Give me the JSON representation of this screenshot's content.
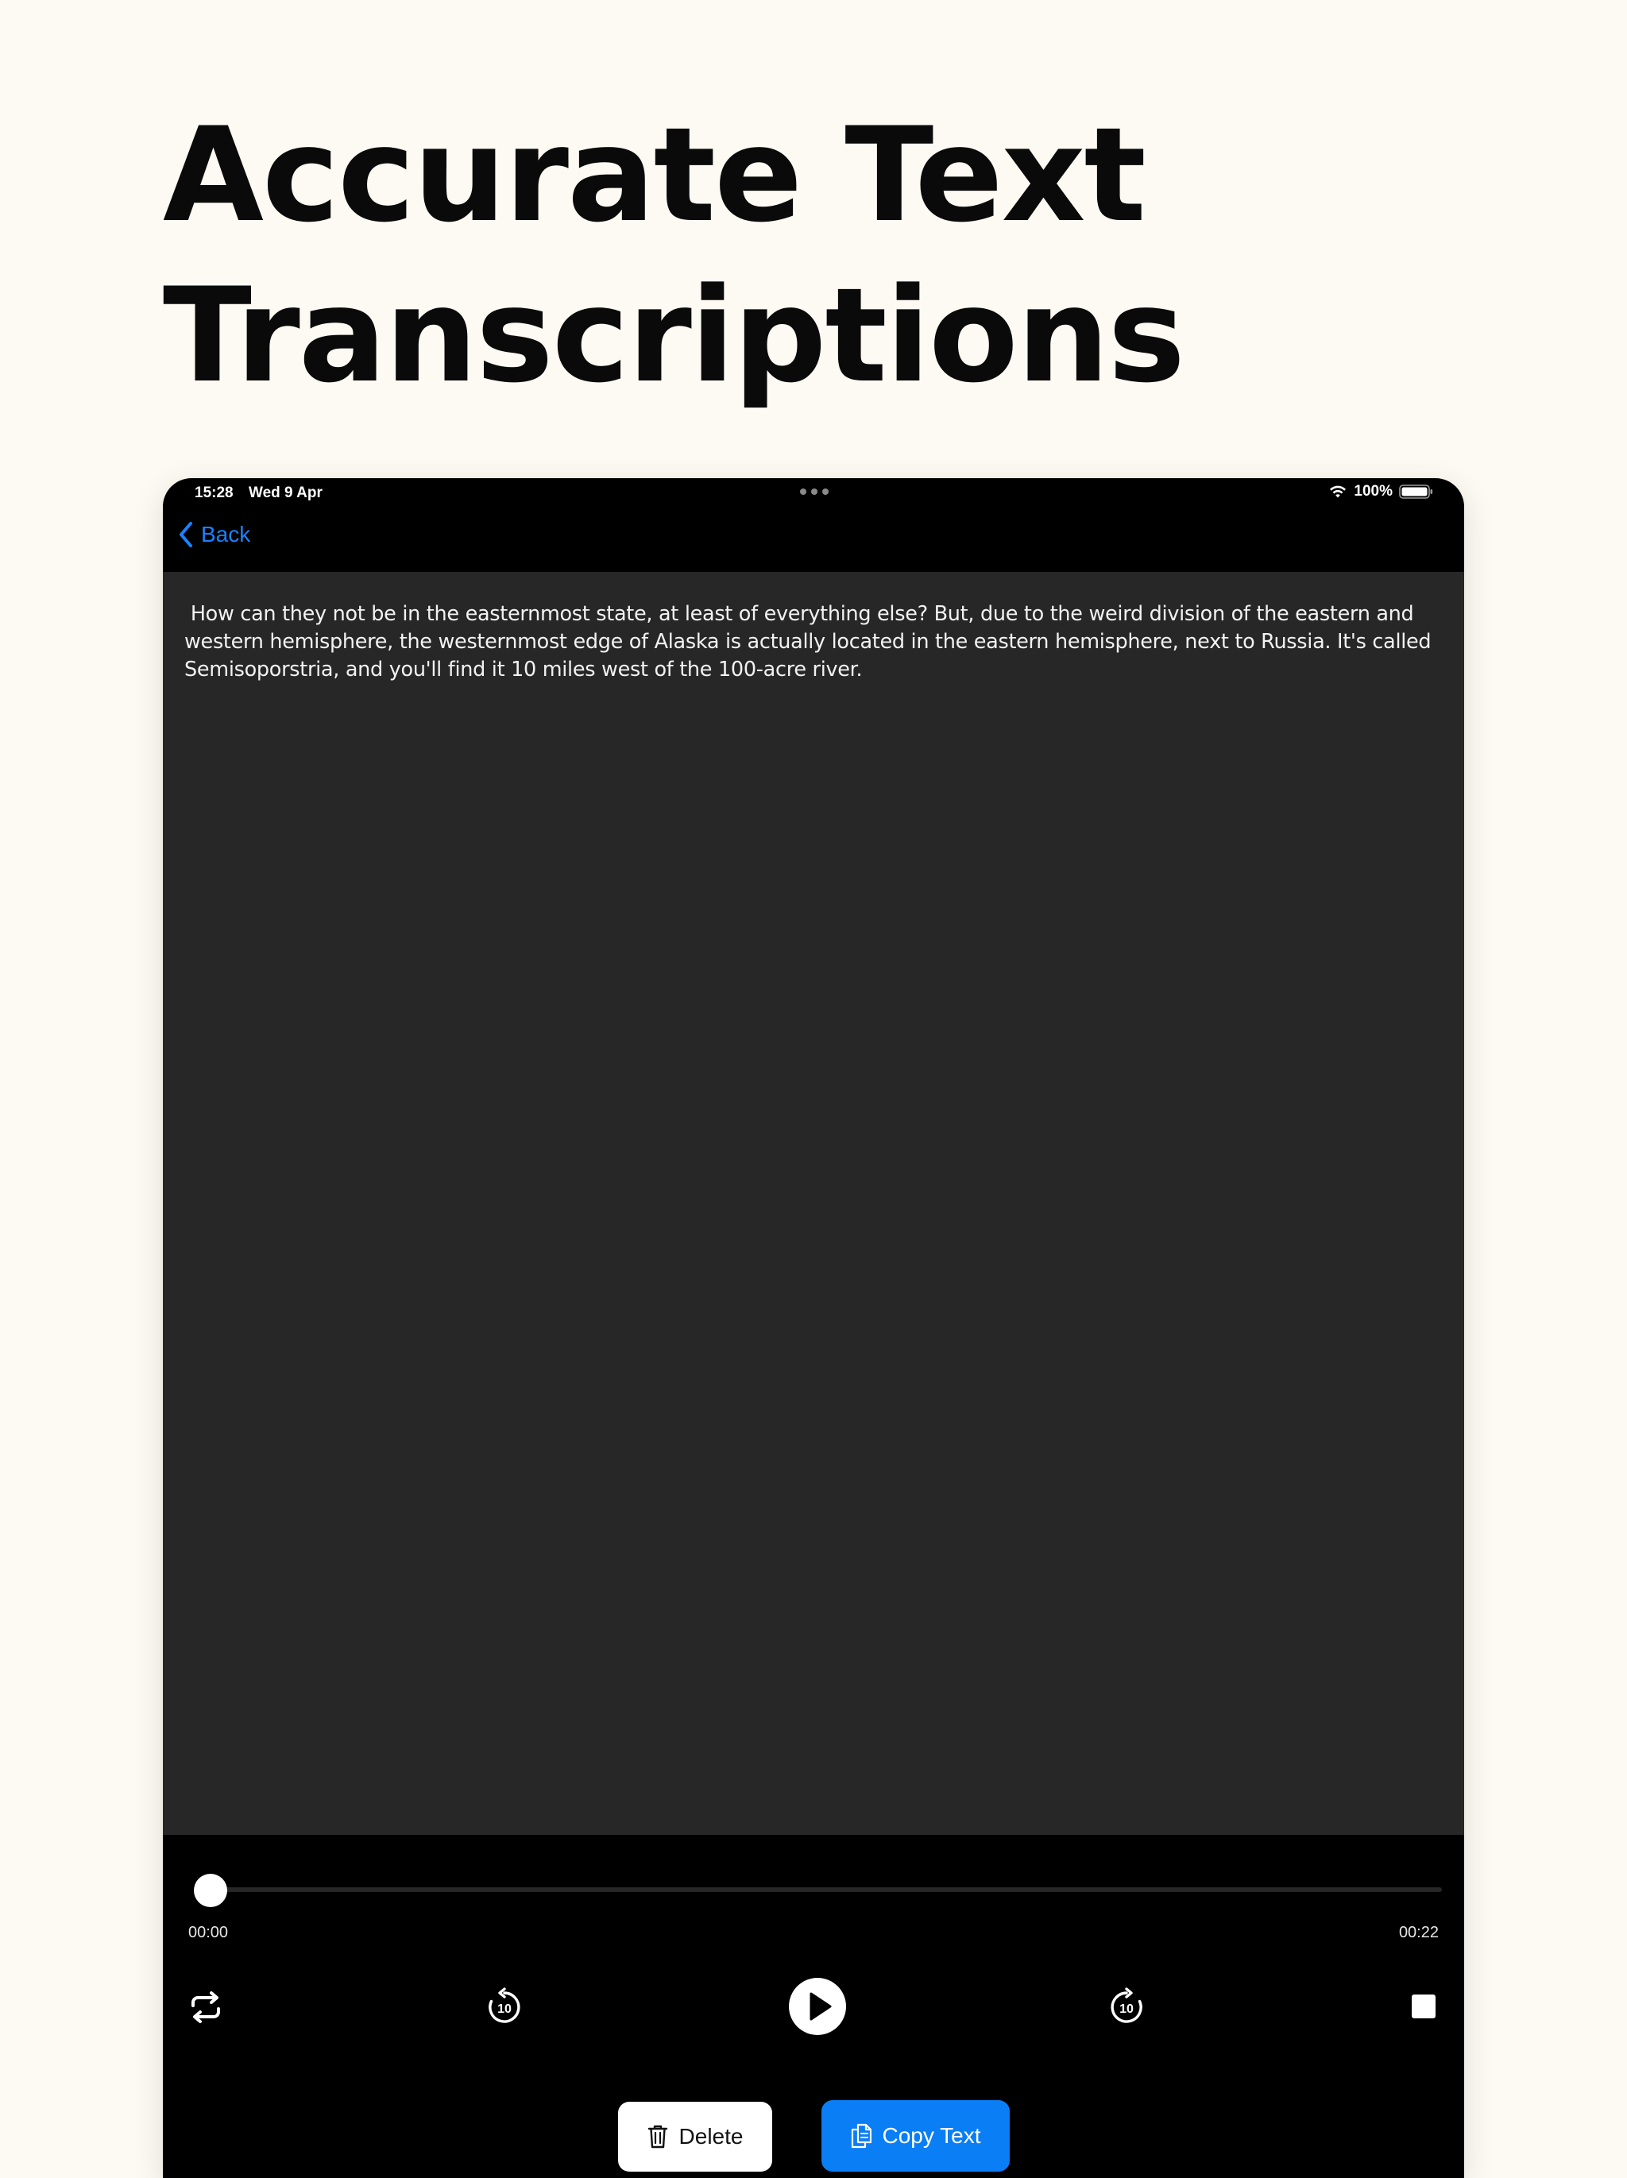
{
  "headline": {
    "line1": "Accurate Text",
    "line2": "Transcriptions"
  },
  "status_bar": {
    "time": "15:28",
    "date": "Wed 9 Apr",
    "battery": "100%",
    "icons": [
      "wifi-icon",
      "battery-icon",
      "multitask-dots-icon"
    ]
  },
  "nav": {
    "back_label": "Back",
    "back_icon": "chevron-left-icon"
  },
  "transcript": {
    "text": " How can they not be in the easternmost state, at least of everything else? But, due to the weird division of the eastern and western hemisphere, the westernmost edge of Alaska is actually located in the eastern hemisphere, next to Russia. It's called Semisoporstria, and you'll find it 10 miles west of the 100-acre river."
  },
  "player": {
    "current_time": "00:00",
    "duration": "00:22",
    "progress_fraction": 0,
    "controls": [
      "repeat-icon",
      "rewind-10-icon",
      "play-icon",
      "forward-10-icon",
      "stop-icon"
    ]
  },
  "actions": {
    "delete_label": "Delete",
    "delete_icon": "trash-icon",
    "copy_label": "Copy Text",
    "copy_icon": "copy-document-icon"
  },
  "colors": {
    "page_background": "#fdf9f3",
    "accent_blue": "#0a7ef5",
    "link_blue": "#1a82ff",
    "panel_background": "#272727"
  }
}
